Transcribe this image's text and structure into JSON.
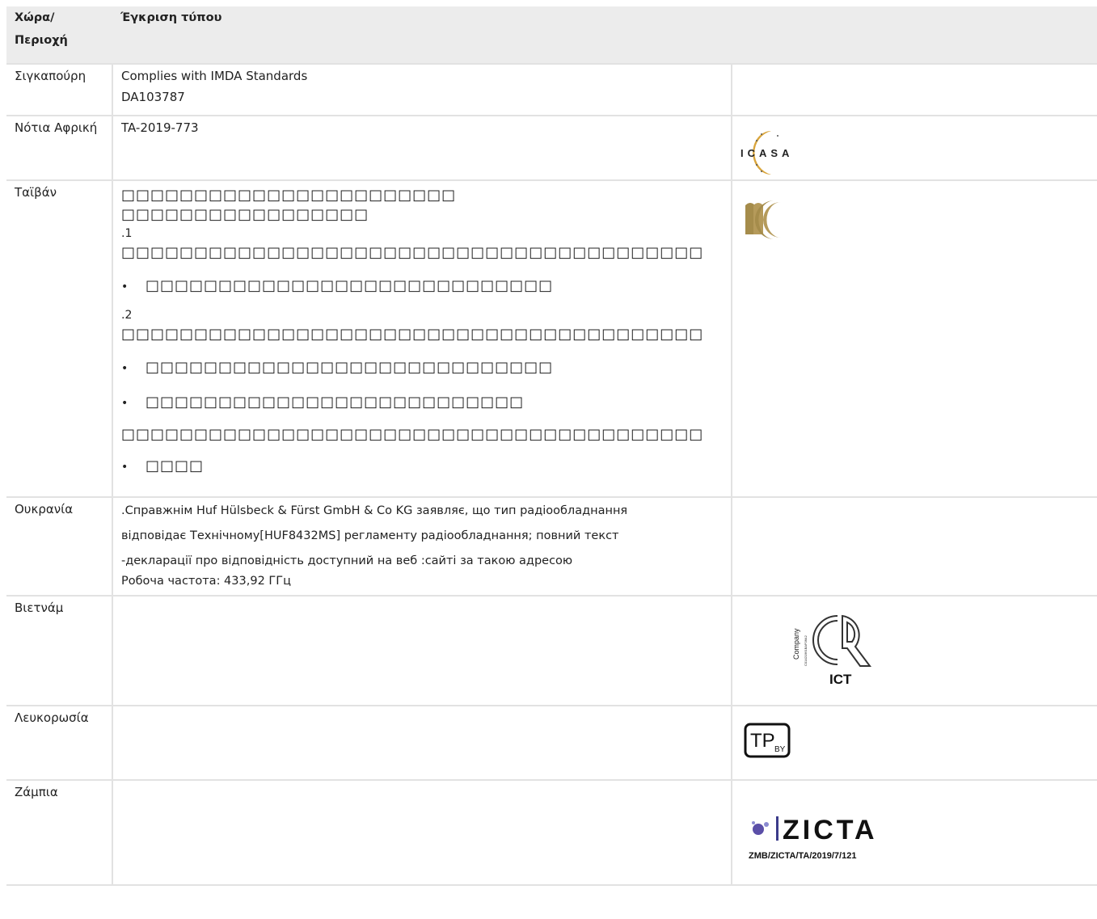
{
  "header": {
    "col_country": "Χώρα/ Περιοχή",
    "col_approval": "Έγκριση τύπου"
  },
  "rows": {
    "singapore": {
      "country": "Σιγκαπούρη",
      "line1": "Complies with IMDA Standards",
      "line2": "DA103787"
    },
    "south_africa": {
      "country": "Νότια Αφρική",
      "approval": "TA-2019-773",
      "logo_text": "ICASA"
    },
    "taiwan": {
      "country": "Ταϊβάν",
      "line1": "□□□□□□□□□□□□□□□□□□□□□□□",
      "line2": "□□□□□□□□□□□□□□□□□",
      "num1": ".1",
      "para1": "□□□□□□□□□□□□□□□□□□□□□□□□□□□□□□□□□□□□□□□□",
      "bullet1": "□□□□□□□□□□□□□□□□□□□□□□□□□□□□",
      "num2": ".2",
      "para2": "□□□□□□□□□□□□□□□□□□□□□□□□□□□□□□□□□□□□□□□□",
      "bullet2": "□□□□□□□□□□□□□□□□□□□□□□□□□□□□",
      "bullet3": "□□□□□□□□□□□□□□□□□□□□□□□□□□",
      "para3": "□□□□□□□□□□□□□□□□□□□□□□□□□□□□□□□□□□□□□□□□",
      "bullet4": "□□□□"
    },
    "ukraine": {
      "country": "Ουκρανία",
      "line1": ".Справжнім Huf Hülsbeck & Fürst GmbH & Co KG заявляє, що тип радіообладнання",
      "line2": "відповідає Технічному[HUF8432MS] регламенту радіообладнання; повний текст",
      "line3": "-декларації про відповідність доступний на веб :сайті за такою адресою",
      "line4": "Робоча частота: 433,92 ГГц"
    },
    "vietnam": {
      "country": "Βιετνάμ",
      "logo_company": "Company",
      "logo_small": "C01421961BAF06A2",
      "logo_label": "ICT"
    },
    "belarus": {
      "country": "Λευκορωσία",
      "logo_text": "TP",
      "logo_sub": "BY"
    },
    "zambia": {
      "country": "Ζάμπια",
      "logo_text": "ZICTA",
      "code": "ZMB/ZICTA/TA/2019/7/121"
    }
  },
  "colors": {
    "header_bg": "#ececec",
    "grid": "#e2e2e2",
    "gold": "#b59a5a",
    "text": "#222222"
  }
}
